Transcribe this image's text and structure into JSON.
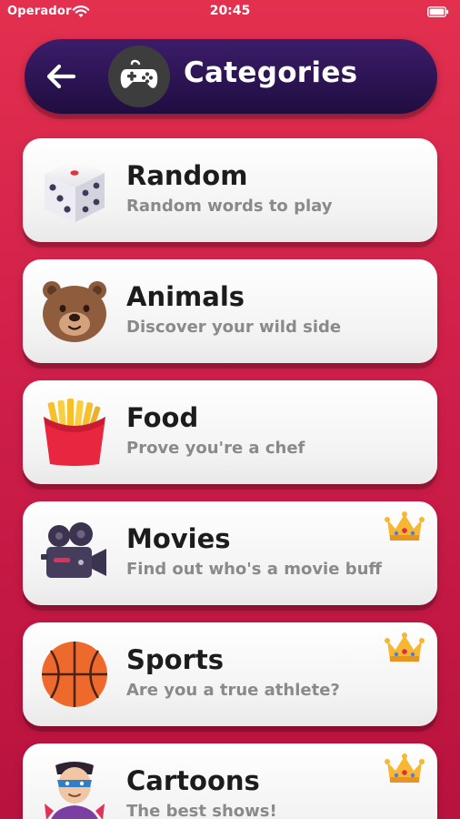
{
  "status_bar": {
    "carrier": "Operador",
    "time": "20:45"
  },
  "header": {
    "title": "Categories",
    "back_icon": "arrow-left-icon",
    "category_icon": "gamepad-icon"
  },
  "categories": [
    {
      "title": "Random",
      "subtitle": "Random words to play",
      "icon": "dice-icon",
      "premium": false
    },
    {
      "title": "Animals",
      "subtitle": "Discover your wild side",
      "icon": "bear-icon",
      "premium": false
    },
    {
      "title": "Food",
      "subtitle": "Prove you're a chef",
      "icon": "fries-icon",
      "premium": false
    },
    {
      "title": "Movies",
      "subtitle": "Find out who's a movie buff",
      "icon": "movie-camera-icon",
      "premium": true
    },
    {
      "title": "Sports",
      "subtitle": "Are you a true athlete?",
      "icon": "basketball-icon",
      "premium": true
    },
    {
      "title": "Cartoons",
      "subtitle": "The best shows!",
      "icon": "superhero-icon",
      "premium": true
    }
  ],
  "colors": {
    "background": "#cf1f4a",
    "header": "#2a1453",
    "card": "#f5f5f5",
    "crown": "#f5a623"
  }
}
